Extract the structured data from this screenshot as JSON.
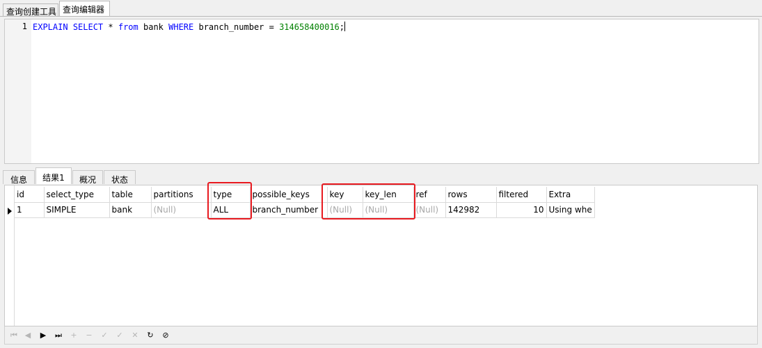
{
  "top_tabs": [
    "查询创建工具",
    "查询编辑器"
  ],
  "editor": {
    "line_number": "1",
    "code": {
      "explain": "EXPLAIN",
      "select": "SELECT",
      "star": " * ",
      "from": "from",
      "table": " bank ",
      "where": "WHERE",
      "condition": " branch_number = ",
      "value": "314658400016",
      "end": ";"
    }
  },
  "result_tabs": [
    "信息",
    "结果1",
    "概况",
    "状态"
  ],
  "grid": {
    "columns": [
      "id",
      "select_type",
      "table",
      "partitions",
      "type",
      "possible_keys",
      "key",
      "key_len",
      "ref",
      "rows",
      "filtered",
      "Extra"
    ],
    "row": {
      "id": "1",
      "select_type": "SIMPLE",
      "table": "bank",
      "partitions": "(Null)",
      "type": "ALL",
      "possible_keys": "branch_number",
      "key": "(Null)",
      "key_len": "(Null)",
      "ref": "(Null)",
      "rows": "142982",
      "filtered": "10",
      "extra": "Using whe"
    }
  },
  "nav": {
    "first": "⏮",
    "prev": "◀",
    "next": "▶",
    "last": "⏭",
    "add": "+",
    "delete": "−",
    "edit": "✓",
    "save": "✓",
    "cancel": "✕",
    "refresh": "↻",
    "stop": "⊘"
  },
  "highlight_color": "#e8191f"
}
